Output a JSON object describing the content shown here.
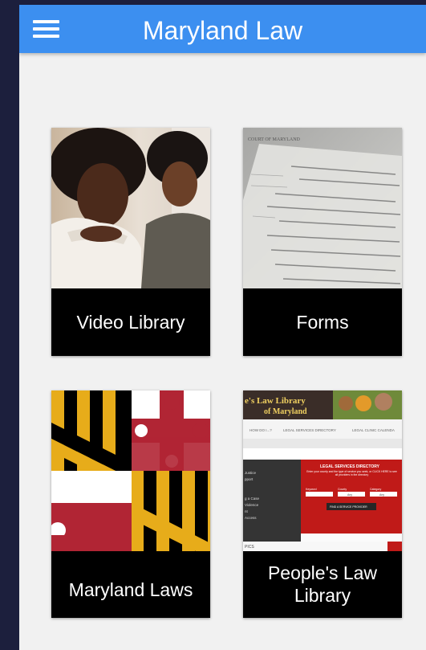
{
  "app": {
    "title": "Maryland Law",
    "menu_icon": "hamburger-menu-icon",
    "accent_color": "#3c8ff0"
  },
  "tiles": [
    {
      "label": "Video Library",
      "image": "people-photo"
    },
    {
      "label": "Forms",
      "image": "legal-form-photo"
    },
    {
      "label": "Maryland Laws",
      "image": "maryland-flag"
    },
    {
      "label": "People's Law Library",
      "label_line1": "People's Law",
      "label_line2": "Library",
      "image": "website-screenshot"
    }
  ],
  "form_image": {
    "header": "COURT OF MARYLAND"
  },
  "website_thumb": {
    "banner_line1": "e's Law Library",
    "banner_line2": "of Maryland",
    "nav_items": [
      "HOW DO I...?",
      "LEGAL SERVICES DIRECTORY",
      "LEGAL CLINIC CALENDA"
    ],
    "panel_title": "LEGAL SERVICES DIRECTORY",
    "panel_text": "Enter your county and the type of service you seek, or CLICK HERE to see all providers in the directory",
    "field_labels": [
      "Keyword",
      "County",
      "Category"
    ],
    "field_values": [
      "",
      "Any",
      "Any"
    ],
    "find_button": "FIND A SERVICE PROVIDER",
    "left_items": [
      "Justice",
      "pport",
      "",
      "g a Case",
      "Violence",
      "nt",
      "Access"
    ],
    "footer": "PICS"
  }
}
